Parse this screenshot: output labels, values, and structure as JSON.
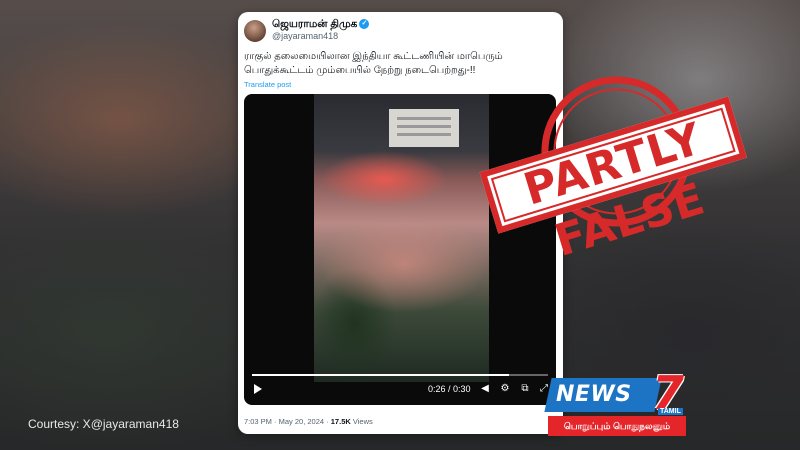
{
  "post": {
    "display_name": "ஜெயராமன் திமுக",
    "handle": "@jayaraman418",
    "text": "ராகுல் தலைமையிலான இந்தியா கூட்டணியின் மாபெரும் பொதுக்கூட்டம் மும்பையில் நேற்று நடைபெற்றது-!!",
    "translate_label": "Translate post",
    "video": {
      "time_display": "0:26 / 0:30",
      "progress": 0.867
    },
    "meta": {
      "time": "7:03 PM",
      "separator": "·",
      "date": "May 20, 2024",
      "views_count": "17.5K",
      "views_label": "Views"
    }
  },
  "overlay": {
    "courtesy": "Courtesy: X@jayaraman418",
    "stamp_text": "PARTLY FALSE",
    "stamp_color": "#d62a2a"
  },
  "logo": {
    "word": "NEWS",
    "number": "7",
    "sub": "TAMIL",
    "tagline": "பொறுப்பும் பொதுநலனும்",
    "blue": "#1d74c4",
    "red": "#e4262b"
  }
}
